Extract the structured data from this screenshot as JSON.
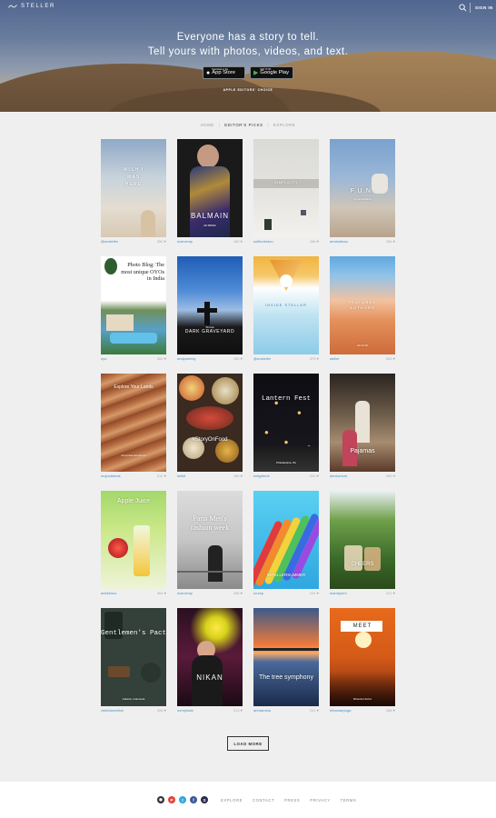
{
  "header": {
    "logo_text": "STELLER",
    "signin_label": "SIGN IN"
  },
  "hero": {
    "line1": "Everyone has a story to tell.",
    "line2": "Tell yours with photos, videos, and text.",
    "appstore_small": "Download on the",
    "appstore_big": "App Store",
    "googleplay_small": "GET IT ON",
    "googleplay_big": "Google Play",
    "editor_choice": "APPLE EDITORS' CHOICE"
  },
  "nav": {
    "home": "HOME",
    "picks": "EDITOR'S PICKS",
    "explore": "EXPLORE",
    "separator": "|"
  },
  "cards": [
    {
      "title": "WISH I WAS HERE",
      "sub": "",
      "user": "@unsteller",
      "count": "350 ♥"
    },
    {
      "title": "BALMAIN",
      "sub": "AD BRIEF",
      "user": "marcreap",
      "count": "189 ♥"
    },
    {
      "title": "SIMPLICITY",
      "sub": "",
      "user": "sofiinobravo",
      "count": "166 ♥"
    },
    {
      "title": "F.U.N.",
      "sub": "fun and beach",
      "user": "annbutleau",
      "count": "154 ♥"
    },
    {
      "title": "Photo Blog: The most unique OYOs in India",
      "sub": "",
      "user": "oyo",
      "count": "400 ♥"
    },
    {
      "title": "DARK GRAVEYARD",
      "sub": "Shimla",
      "user": "andyamesy",
      "count": "189 ♥"
    },
    {
      "title": "INSIDE STELLER",
      "sub": "",
      "user": "@unsteller",
      "count": "375 ♥"
    },
    {
      "title": "FEATURED AUTHORS",
      "sub": "03.13.15",
      "user": "steller",
      "count": "263 ♥"
    },
    {
      "title": "Explore Your Lands",
      "sub": "#mojoutlandsexplored",
      "user": "mojoutlands",
      "count": "212 ♥"
    },
    {
      "title": "#StoryOnFood",
      "sub": "",
      "user": "kelkit",
      "count": "186 ♥"
    },
    {
      "title": "Lantern Fest",
      "sub": "Philadelphia, PA",
      "user": "hetgeterie",
      "count": "220 ♥"
    },
    {
      "title": "Pajamas",
      "sub": "",
      "user": "alexismont",
      "count": "269 ♥"
    },
    {
      "title": "Apple Juice",
      "sub": "",
      "user": "ankfresco",
      "count": "364 ♥"
    },
    {
      "title": "Paris Men's fashion week",
      "sub": "",
      "user": "marcreap",
      "count": "268 ♥"
    },
    {
      "title": "#STELLERSUMMER",
      "sub": "",
      "user": "crump",
      "count": "231 ♥"
    },
    {
      "title": "CHEERS",
      "sub": "",
      "user": "mandymm",
      "count": "221 ♥"
    },
    {
      "title": "Gentlemen's Pact",
      "sub": "Jakarta, Indonesia",
      "user": "vietchlaverlich",
      "count": "206 ♥"
    },
    {
      "title": "NIKAN",
      "sub": "",
      "user": "nernyhate",
      "count": "213 ♥"
    },
    {
      "title": "The tree symphony",
      "sub": "",
      "user": "arenamina",
      "count": "241 ♥"
    },
    {
      "title": "MEET",
      "sub": "Miranda Nuñez",
      "user": "hihamarpoga",
      "count": "268 ♥"
    }
  ],
  "load_more_label": "LOAD MORE",
  "footer": {
    "links": [
      "EXPLORE",
      "CONTACT",
      "PRESS",
      "PRIVACY",
      "TERMS"
    ],
    "social": [
      "github-icon",
      "pinterest-icon",
      "twitter-icon",
      "facebook-icon",
      "steller-icon"
    ]
  }
}
